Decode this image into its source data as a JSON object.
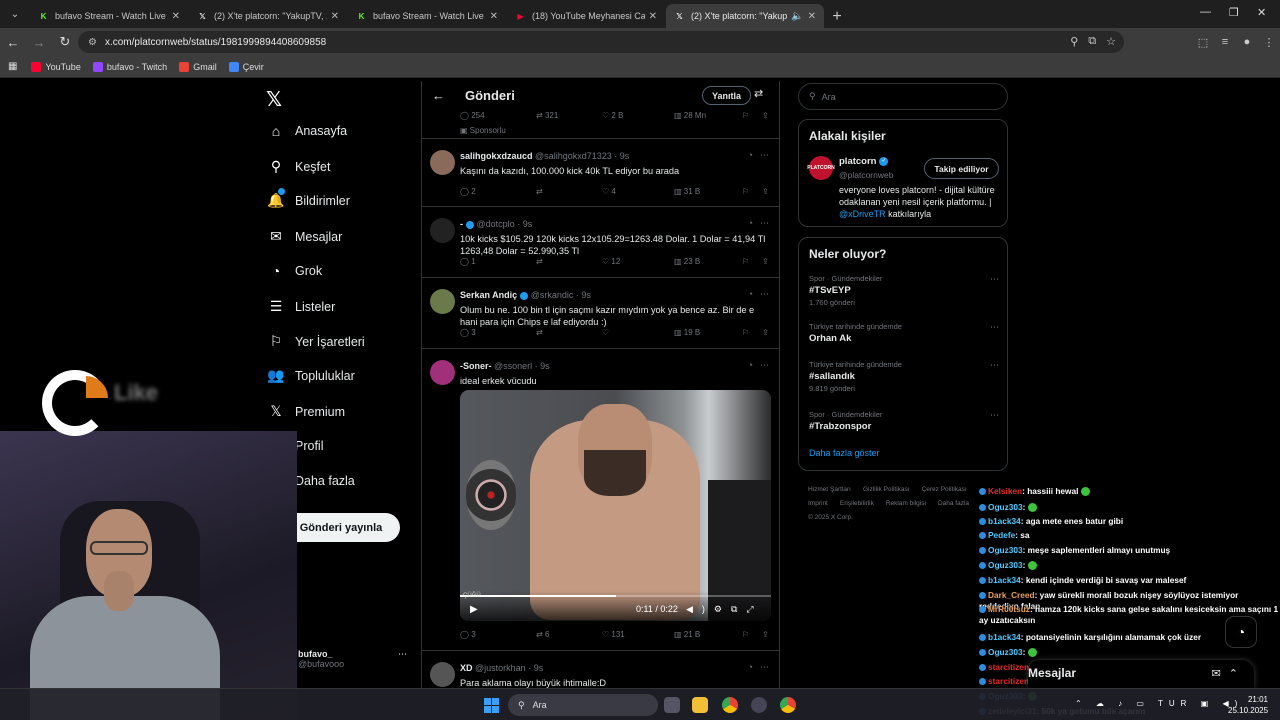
{
  "browser": {
    "tabs": [
      {
        "title": "bufavo Stream - Watch Live on",
        "favicon": "kick-icon",
        "color": "#53fc18",
        "active": false
      },
      {
        "title": "(2) X'te platcorn: \"YakupTV, 12(",
        "favicon": "x-icon",
        "color": "#ffffff",
        "active": false
      },
      {
        "title": "bufavo Stream - Watch Live on",
        "favicon": "kick-icon",
        "color": "#53fc18",
        "active": false
      },
      {
        "title": "(18) YouTube Meyhanesi Canlı Y",
        "favicon": "youtube-icon",
        "color": "#ff0033",
        "active": false
      },
      {
        "title": "(2) X'te platcorn: \"YakupTV,",
        "favicon": "x-icon",
        "color": "#ffffff",
        "active": true
      }
    ],
    "url": "x.com/platcornweb/status/1981999894408609858",
    "bookmarks": [
      {
        "label": "YouTube",
        "color": "#ff0033"
      },
      {
        "label": "bufavo - Twitch",
        "color": "#9146ff"
      },
      {
        "label": "Gmail",
        "color": "#ea4335"
      },
      {
        "label": "Çevir",
        "color": "#4285f4"
      }
    ]
  },
  "nav": {
    "items": [
      {
        "label": "Anasayfa",
        "icon": "home-icon",
        "glyph": "⌂"
      },
      {
        "label": "Keşfet",
        "icon": "search-icon",
        "glyph": "⚲"
      },
      {
        "label": "Bildirimler",
        "icon": "bell-icon",
        "glyph": "🔔"
      },
      {
        "label": "Mesajlar",
        "icon": "mail-icon",
        "glyph": "✉"
      },
      {
        "label": "Grok",
        "icon": "grok-icon",
        "glyph": "◔"
      },
      {
        "label": "Listeler",
        "icon": "list-icon",
        "glyph": "☰"
      },
      {
        "label": "Yer İşaretleri",
        "icon": "bookmark-icon",
        "glyph": "⚐"
      },
      {
        "label": "Topluluklar",
        "icon": "communities-icon",
        "glyph": "👥"
      },
      {
        "label": "Premium",
        "icon": "x-logo-icon",
        "glyph": "𝕏"
      },
      {
        "label": "Profil",
        "icon": "profile-icon",
        "glyph": "◯"
      },
      {
        "label": "Daha fazla",
        "icon": "more-icon",
        "glyph": "⋯"
      }
    ],
    "post_button": "Gönderi yayınla",
    "account_name": "bufavo_",
    "account_handle": "@bufavooo"
  },
  "overlay": {
    "logo_text": "Like"
  },
  "center": {
    "title": "Gönderi",
    "reply_button": "Yanıtla",
    "sponsored_stats": {
      "replies": "254",
      "reposts": "321",
      "likes": "2 B",
      "views": "28 Mn"
    },
    "sponsored_label": "Sponsorlu",
    "tweets": [
      {
        "name": "salihgokxdzaucd",
        "handle": "@salihgokxd71323",
        "time": "9s",
        "text": "Kaşını da kazıdı, 100.000 kick 40k TL ediyor bu arada",
        "replies": "2",
        "reposts": "",
        "likes": "4",
        "views": "31 B",
        "avatar_color": "#8a6a5a"
      },
      {
        "name": "-",
        "handle": "@dotcplo",
        "time": "9s",
        "verified": true,
        "text": "10k kicks $105.29 120k kicks 12x105.29=1263.48 Dolar.  1 Dolar = 41,94 Tl 1263,48 Dolar = 52.990,35 Tl",
        "replies": "1",
        "reposts": "",
        "likes": "12",
        "views": "23 B",
        "avatar_color": "#222222"
      },
      {
        "name": "Serkan Andiç",
        "handle": "@srkandic",
        "time": "9s",
        "verified": true,
        "text": "Olum bu ne. 100 bin tl için saçmı kazır mıydım yok ya bence az. Bir de e hani para için Chips e laf ediyordu :)",
        "replies": "3",
        "reposts": "",
        "likes": "",
        "views": "19 B",
        "avatar_color": "#6b7a4a"
      },
      {
        "name": "-Soner-",
        "handle": "@ssonerl",
        "time": "9s",
        "text": "ideal erkek vücudu",
        "replies": "3",
        "reposts": "6",
        "likes": "131",
        "views": "21 B",
        "avatar_color": "#a0307a"
      },
      {
        "name": "XD",
        "handle": "@justorkhan",
        "time": "9s",
        "text": "Para aklama olayı büyük ihtimalle:D",
        "avatar_color": "#555555"
      }
    ],
    "video": {
      "time": "0:11 / 0:22",
      "progress": 0.5,
      "tag": "ÇÜĞÜ"
    }
  },
  "right": {
    "search_placeholder": "Ara",
    "related_title": "Alakalı kişiler",
    "person": {
      "name": "platcorn",
      "handle": "@platcornweb",
      "avatar_text": "PLATCORN",
      "follow_label": "Takip ediliyor",
      "bio": "everyone loves platcorn! - dijital kültüre odaklanan yeni nesil içerik platformu. |",
      "bio_link": "@xDriveTR",
      "bio_tail": "katkılarıyla"
    },
    "trends_title": "Neler oluyor?",
    "trends": [
      {
        "category": "Spor · Gündemdekiler",
        "name": "#TSvEYP",
        "count": "1.760 gönderi"
      },
      {
        "category": "Türkiye tarihinde gündemde",
        "name": "Orhan Ak",
        "count": ""
      },
      {
        "category": "Türkiye tarihinde gündemde",
        "name": "#sallandık",
        "count": "9.819 gönderi"
      },
      {
        "category": "Spor · Gündemdekiler",
        "name": "#Trabzonspor",
        "count": ""
      }
    ],
    "show_more": "Daha fazla göster",
    "footer": [
      "Hizmet Şartları",
      "Gizlilik Politikası",
      "Çerez Politikası",
      "Imprint",
      "Erişilebilirlik",
      "Reklam bilgisi",
      "Daha fazla",
      "© 2025 X Corp."
    ]
  },
  "chat": [
    {
      "user": "Kelsiken",
      "text": ": hassiii hewal",
      "color": "#e03030",
      "emote": true
    },
    {
      "user": "Oguz303",
      "text": ":",
      "color": "#55c8ff",
      "emote": true
    },
    {
      "user": "b1ack34",
      "text": ": aga mete enes batur gibi",
      "color": "#55c8ff"
    },
    {
      "user": "Pedefe",
      "text": ": sa",
      "color": "#55c8ff"
    },
    {
      "user": "Oguz303",
      "text": ": meşe saplementleri almayı unutmuş",
      "color": "#55c8ff"
    },
    {
      "user": "Oguz303",
      "text": ":",
      "color": "#55c8ff",
      "emote": true
    },
    {
      "user": "b1ack34",
      "text": ": kendi içinde verdiği bi savaş var malesef",
      "color": "#55c8ff"
    },
    {
      "user": "Dark_Creed",
      "text": ": yaw sürekli morali bozuk nişey söylüyoz istemiyor reddediyo falan",
      "color": "#e8a060"
    },
    {
      "user": "MrR00tsuz",
      "text": ": hamza 120k kicks sana gelse sakalını kesiceksin ama saçını 1 ay uzatıcaksın",
      "color": "#e8a060"
    },
    {
      "user": "b1ack34",
      "text": ": potansiyelinin karşılığını alamamak çok üzer",
      "color": "#55c8ff"
    },
    {
      "user": "Oguz303",
      "text": ":",
      "color": "#55c8ff",
      "emote": true
    },
    {
      "user": "starcitizen",
      "text": ":",
      "color": "#e03030",
      "emote": true
    },
    {
      "user": "starcitizen",
      "text": ":",
      "color": "#e03030",
      "emote": true
    },
    {
      "user": "Oguz303",
      "text": ":",
      "color": "#55c8ff",
      "emote": true
    },
    {
      "user": "zedeleyici31",
      "text": ": 50k ya gotumu bile açarım",
      "color": "#c0c0ff"
    }
  ],
  "drawer": {
    "title": "Mesajlar"
  },
  "taskbar": {
    "search": "Ara",
    "lang": "TUR",
    "time": "21:01",
    "date": "25.10.2025"
  }
}
